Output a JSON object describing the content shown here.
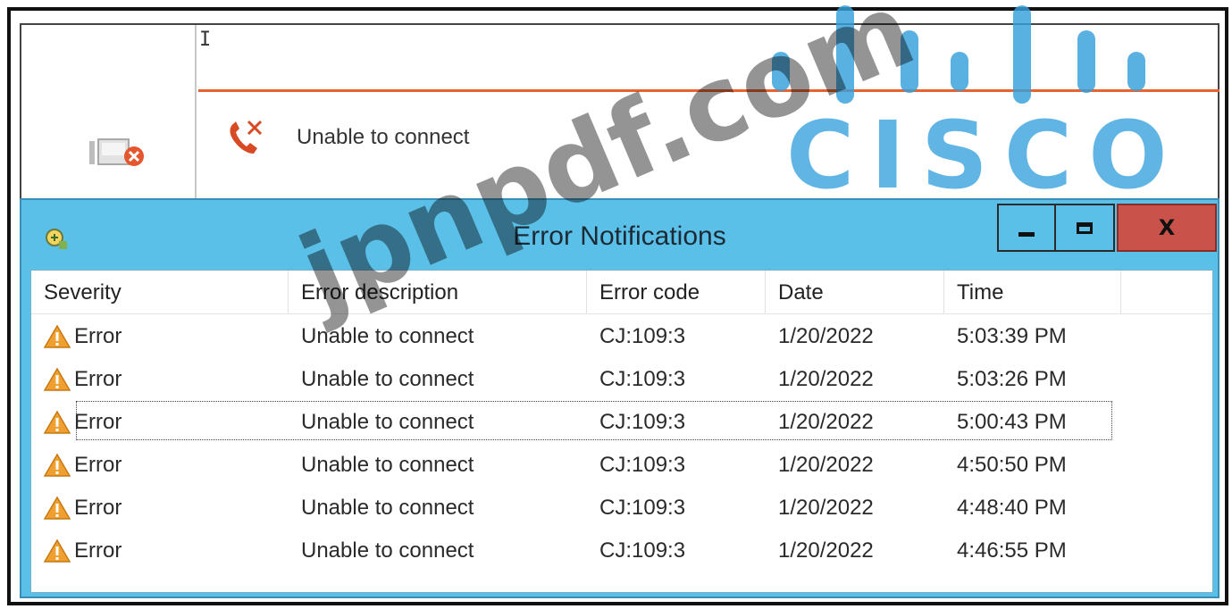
{
  "status_pane": {
    "cursor_glyph": "I",
    "message": "Unable to connect"
  },
  "window": {
    "title": "Error Notifications",
    "buttons": {
      "minimize_icon": "minimize-icon",
      "maximize_icon": "maximize-icon",
      "close_label": "X"
    }
  },
  "table": {
    "columns": [
      "Severity",
      "Error description",
      "Error code",
      "Date",
      "Time"
    ],
    "rows": [
      {
        "severity": "Error",
        "description": "Unable to connect",
        "code": "CJ:109:3",
        "date": "1/20/2022",
        "time": "5:03:39 PM"
      },
      {
        "severity": "Error",
        "description": "Unable to connect",
        "code": "CJ:109:3",
        "date": "1/20/2022",
        "time": "5:03:26 PM"
      },
      {
        "severity": "Error",
        "description": "Unable to connect",
        "code": "CJ:109:3",
        "date": "1/20/2022",
        "time": "5:00:43 PM"
      },
      {
        "severity": "Error",
        "description": "Unable to connect",
        "code": "CJ:109:3",
        "date": "1/20/2022",
        "time": "4:50:50 PM"
      },
      {
        "severity": "Error",
        "description": "Unable to connect",
        "code": "CJ:109:3",
        "date": "1/20/2022",
        "time": "4:48:40 PM"
      },
      {
        "severity": "Error",
        "description": "Unable to connect",
        "code": "CJ:109:3",
        "date": "1/20/2022",
        "time": "4:46:55 PM"
      }
    ],
    "selected_row": 2
  },
  "watermark": {
    "brand": "CISCO",
    "domain": "jpnpdf.com"
  },
  "colors": {
    "titlebar": "#5bc0e8",
    "close_button": "#c9534a",
    "accent_rule": "#e8632f",
    "warning": "#f0a030"
  }
}
